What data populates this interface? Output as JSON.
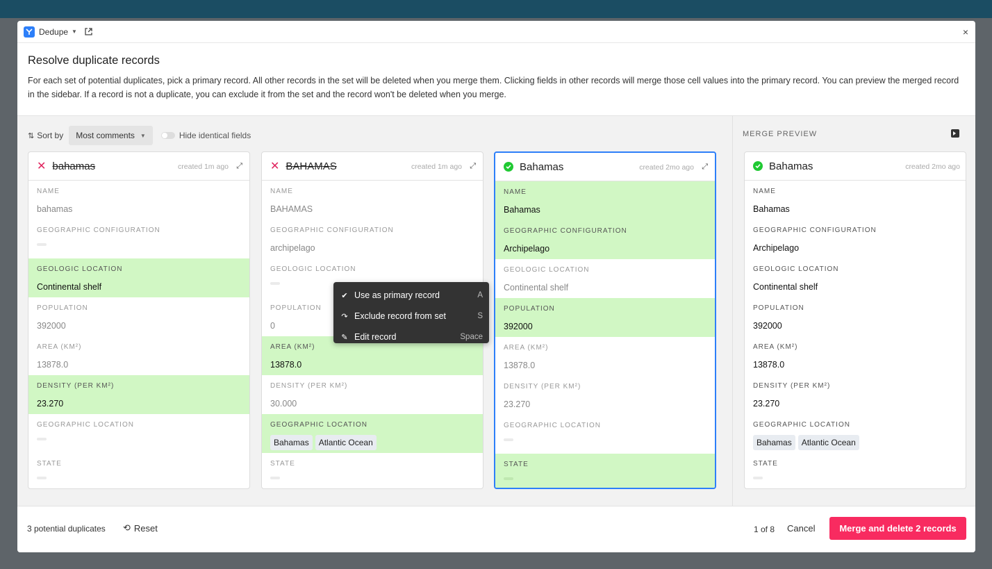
{
  "window": {
    "app_title": "Dedupe",
    "app_icon": "dedupe-icon",
    "external_icon": "external-link-icon",
    "close_glyph": "×"
  },
  "header": {
    "title": "Resolve duplicate records",
    "description": "For each set of potential duplicates, pick a primary record. All other records in the set will be deleted when you merge them. Clicking fields in other records will merge those cell values into the primary record. You can preview the merged record in the sidebar. If a record is not a duplicate, you can exclude it from the set and the record won't be deleted when you merge."
  },
  "toolbar": {
    "sort_label": "Sort by",
    "sort_value": "Most comments",
    "hide_identical_label": "Hide identical fields",
    "hide_identical_on": false
  },
  "merge_preview": {
    "heading": "MERGE PREVIEW"
  },
  "field_labels": [
    "NAME",
    "GEOGRAPHIC CONFIGURATION",
    "GEOLOGIC LOCATION",
    "POPULATION",
    "AREA (KM²)",
    "DENSITY (PER KM²)",
    "GEOGRAPHIC LOCATION",
    "STATE"
  ],
  "cards": [
    {
      "title": "bahamas",
      "status": "excluded",
      "created": "created 1m ago",
      "values": [
        "bahamas",
        "",
        "Continental shelf",
        "392000",
        "13878.0",
        "23.270",
        "",
        ""
      ]
    },
    {
      "title": "BAHAMAS",
      "status": "excluded",
      "created": "created 1m ago",
      "values": [
        "BAHAMAS",
        "archipelago",
        "",
        "0",
        "13878.0",
        "30.000",
        "",
        ""
      ],
      "geo_chips": [
        "Bahamas",
        "Atlantic Ocean"
      ]
    },
    {
      "title": "Bahamas",
      "status": "primary",
      "created": "created 2mo ago",
      "values": [
        "Bahamas",
        "Archipelago",
        "Continental shelf",
        "392000",
        "13878.0",
        "23.270",
        "",
        ""
      ]
    },
    {
      "title": "Bahamas",
      "status": "preview",
      "created": "created 2mo ago",
      "values": [
        "Bahamas",
        "Archipelago",
        "Continental shelf",
        "392000",
        "13878.0",
        "23.270",
        "",
        ""
      ],
      "geo_chips": [
        "Bahamas",
        "Atlantic Ocean"
      ]
    }
  ],
  "context_menu": [
    {
      "label": "Use as primary record",
      "shortcut": "A",
      "icon": "check-icon"
    },
    {
      "label": "Exclude record from set",
      "shortcut": "S",
      "icon": "undo-icon"
    },
    {
      "label": "Edit record",
      "shortcut": "Space",
      "icon": "pencil-icon"
    }
  ],
  "footer": {
    "count": "3 potential duplicates",
    "reset": "Reset",
    "pager": "1 of 8",
    "cancel": "Cancel",
    "merge": "Merge and delete 2 records"
  },
  "colors": {
    "accent": "#2d7ff9",
    "merge_button": "#f82b60",
    "highlight": "#d1f7c4",
    "excluded": "#e0245e",
    "primary_check": "#20c933"
  }
}
